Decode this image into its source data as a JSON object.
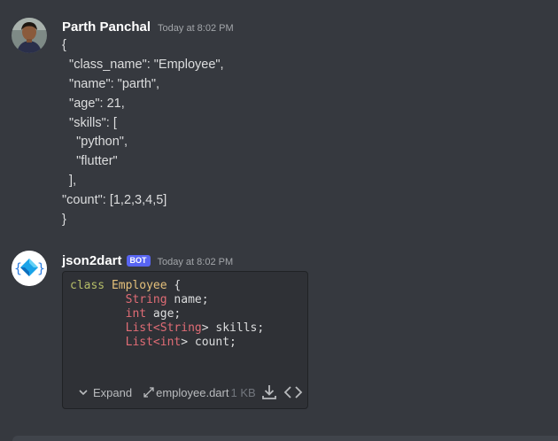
{
  "messages": [
    {
      "username": "Parth Panchal",
      "timestamp": "Today at 8:02 PM",
      "lines": [
        "{",
        "  \"class_name\": \"Employee\",",
        "  \"name\": \"parth\",",
        "  \"age\": 21,",
        "  \"skills\": [",
        "    \"python\",",
        "    \"flutter\"",
        "  ],",
        "\"count\": [1,2,3,4,5]",
        "}"
      ]
    },
    {
      "username": "json2dart",
      "bot_tag": "BOT",
      "timestamp": "Today at 8:02 PM",
      "attachment": {
        "code_lines": [
          [
            {
              "t": "class",
              "c": "kw"
            },
            {
              "t": " ",
              "c": "plain"
            },
            {
              "t": "Employee",
              "c": "cls"
            },
            {
              "t": " {",
              "c": "plain"
            }
          ],
          [
            {
              "t": "        ",
              "c": "plain"
            },
            {
              "t": "String",
              "c": "typ"
            },
            {
              "t": " name;",
              "c": "plain"
            }
          ],
          [
            {
              "t": "        ",
              "c": "plain"
            },
            {
              "t": "int",
              "c": "typ"
            },
            {
              "t": " age;",
              "c": "plain"
            }
          ],
          [
            {
              "t": "        ",
              "c": "plain"
            },
            {
              "t": "List<",
              "c": "typ"
            },
            {
              "t": "String",
              "c": "typ"
            },
            {
              "t": "> skills;",
              "c": "plain"
            }
          ],
          [
            {
              "t": "        ",
              "c": "plain"
            },
            {
              "t": "List<",
              "c": "typ"
            },
            {
              "t": "int",
              "c": "typ"
            },
            {
              "t": "> count;",
              "c": "plain"
            }
          ]
        ],
        "expand_label": "Expand",
        "filename": "employee.dart",
        "file_size": "1 KB"
      }
    }
  ],
  "icons": {
    "expand": "chevron-down-icon",
    "file": "arrows-expand-icon",
    "download": "download-icon",
    "view_source": "code-brackets-icon"
  },
  "colors": {
    "background": "#36393f",
    "embed_bg": "#2f3136",
    "bot_tag": "#5865f2",
    "code_keyword": "#b5bd68",
    "code_class": "#e5c07b",
    "code_type": "#e06c75"
  }
}
